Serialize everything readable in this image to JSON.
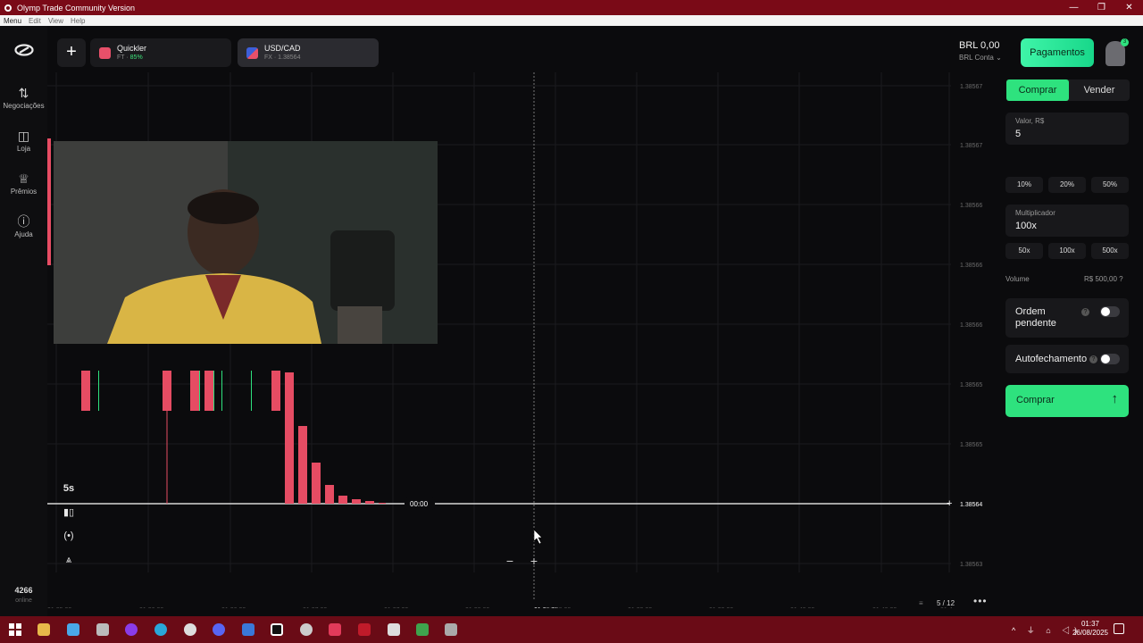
{
  "window": {
    "title": "Olymp Trade Community Version",
    "controls": [
      "—",
      "❐",
      "✕"
    ]
  },
  "menubar": [
    "Menu",
    "Edit",
    "View",
    "Help"
  ],
  "leftnav": {
    "items": [
      {
        "label": "Negociações",
        "icon": "arrows-updown-icon"
      },
      {
        "label": "Loja",
        "icon": "bag-icon"
      },
      {
        "label": "Prêmios",
        "icon": "trophy-icon"
      },
      {
        "label": "Ajuda",
        "icon": "help-icon"
      }
    ],
    "online_count": "4266",
    "online_label": "online"
  },
  "header": {
    "add_tab": "+",
    "tabs": [
      {
        "name": "Quickler",
        "sub_prefix": "FT · ",
        "sub_value": "85%",
        "color": "#e8506a",
        "active": false
      },
      {
        "name": "USD/CAD",
        "sub_prefix": "FX · 1.38564",
        "sub_value": "",
        "color": "#7b6cd9",
        "active": true
      }
    ],
    "balance": "BRL 0,00",
    "account": "BRL Conta",
    "pay_button": "Pagamentos",
    "avatar_badge": "3"
  },
  "chart": {
    "price_labels": [
      "1.38567",
      "1.38567",
      "1.38566",
      "1.38566",
      "1.38566",
      "1.38565",
      "1.38565",
      "1.38564",
      "1.38563"
    ],
    "current_price": "1.38564",
    "time_labels": [
      "01:35:30",
      "01:36:00",
      "01:36:30",
      "01:37:00",
      "01:37:30",
      "01:38:00",
      "01:38:25",
      "01:38:30",
      "01:39:00",
      "01:39:30",
      "01:40:00",
      "01:40:30",
      "01:4"
    ],
    "cursor_time": "01:38:25",
    "timer": "00:00",
    "timeframe": "5s",
    "zoom_out": "−",
    "zoom_in": "+",
    "pager": "5 / 12",
    "more": "•••",
    "colors": {
      "down": "#e64c63",
      "up": "#2ee27e",
      "grid": "#1b1b1e",
      "line": "#ffffff"
    }
  },
  "chart_data": {
    "type": "bar",
    "x": [
      "01:35:30",
      "01:36:00",
      "01:36:30",
      "01:37:00",
      "01:37:30",
      "01:38:00",
      "01:38:30",
      "01:39:00",
      "01:39:30",
      "01:40:00",
      "01:40:30"
    ],
    "ylim": [
      1.38563,
      1.38567
    ],
    "current_price": 1.38564
  },
  "order_panel": {
    "buy_tab": "Comprar",
    "sell_tab": "Vender",
    "amount_label": "Valor, R$",
    "amount_value": "5",
    "amount_chips": [
      "10%",
      "20%",
      "50%"
    ],
    "multiplier_label": "Multiplicador",
    "multiplier_value": "100x",
    "multiplier_chips": [
      "50x",
      "100x",
      "500x"
    ],
    "volume_label": "Volume",
    "volume_value": "R$ 500,00",
    "pending_label": "Ordem pendente",
    "autoclose_label": "Autofechamento",
    "buy_button": "Comprar",
    "buy_arrow": "↑"
  },
  "taskbar": {
    "time": "01:37",
    "date": "26/08/2025",
    "tray": "^ ⏚ ⌂ ◁)"
  }
}
